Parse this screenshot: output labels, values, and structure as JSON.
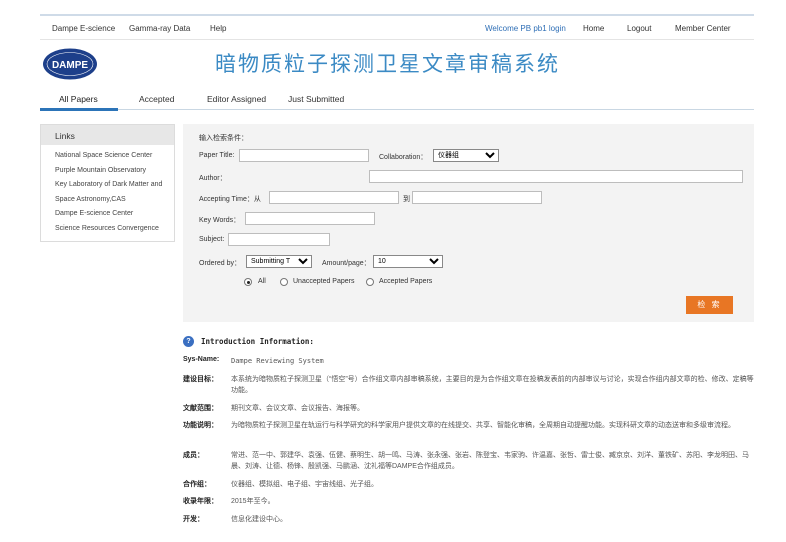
{
  "nav": {
    "left": [
      "Dampe E-science",
      "Gamma-ray Data",
      "Help"
    ],
    "welcome": "Welcome PB pb1 login",
    "right": [
      "Home",
      "Logout",
      "Member Center"
    ]
  },
  "header": {
    "logo_text": "DAMPE",
    "title": "暗物质粒子探测卫星文章审稿系统"
  },
  "tabs": [
    "All Papers",
    "Accepted",
    "Editor Assigned",
    "Just Submitted"
  ],
  "links": {
    "title": "Links",
    "items": [
      "National Space Science Center",
      "Purple Mountain Observatory",
      "Key Laboratory of Dark Matter and",
      "Space Astronomy,CAS",
      "Dampe E-science Center",
      "Science Resources Convergence"
    ]
  },
  "search": {
    "heading": "输入检索条件：",
    "paper_title_label": "Paper Title:",
    "collaboration_label": "Collaboration：",
    "collaboration_value": "仪器组",
    "author_label": "Author：",
    "accepting_time_label": "Accepting Time：从",
    "to_label": "到",
    "keywords_label": "Key Words：",
    "subject_label": "Subject:",
    "ordered_by_label": "Ordered by：",
    "ordered_by_value": "Submitting T",
    "amount_label": "Amount/page：",
    "amount_value": "10",
    "radio_options": [
      "All",
      "Unaccepted Papers",
      "Accepted Papers"
    ],
    "radio_selected": 0,
    "button": "检 索"
  },
  "intro": {
    "heading": "Introduction Information:",
    "rows": [
      {
        "key": "Sys-Name:",
        "value": "Dampe Reviewing System"
      },
      {
        "key": "建设目标：",
        "value": "本系统为暗物质粒子探测卫星（“悟空”号）合作组文章内部审稿系统，主要目的是为合作组文章在投稿发表前的内部审议与讨论，实现合作组内部文章的检、修改、定稿等功能。"
      },
      {
        "key": "文献范围：",
        "value": "期刊文章、会议文章、会议报告、海报等。"
      },
      {
        "key": "功能说明：",
        "value": "为暗物质粒子探测卫星在轨运行与科学研究的科学家用户提供文章的在线提交、共享、智能化审稿，全周期自动提醒功能。实现科研文章的动态送审和多级审流程。"
      },
      {
        "key": "成员：",
        "value": "常进、范一中、郭建华、袁强、伍健、蔡明生、胡一鸣、马涛、张永强、张岩、陈登宝、韦家驹、许温嘉、张哲、雷士俊、臧京京、刘洋、董铁矿、苏阳、李龙明田、马晨、刘涛、让德、杨锋、殷凯强、马鹏涵、沈礼福等DAMPE合作组成员。"
      },
      {
        "key": "合作组：",
        "value": "仪器组、模拟组、电子组、宇宙线组、光子组。"
      },
      {
        "key": "收录年限：",
        "value": "2015年至今。"
      },
      {
        "key": "开发：",
        "value": "信息化建设中心。"
      }
    ]
  },
  "colors": {
    "accent": "#2c74b8",
    "title": "#3b8ac4",
    "button": "#e87624"
  }
}
